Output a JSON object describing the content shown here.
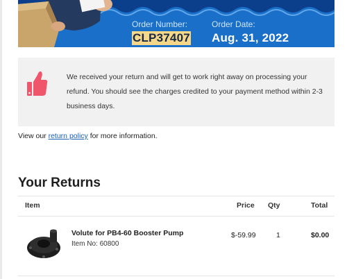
{
  "header": {
    "order_number_label": "Order Number:",
    "order_number": "CLP37407",
    "order_date_label": "Order Date:",
    "order_date": "Aug. 31, 2022",
    "banner_color": "#1a6fc9",
    "highlight_color": "#f5d78a"
  },
  "notice": {
    "icon": "thumbs-up-icon",
    "icon_color": "#f0566b",
    "text": "We received your return and will get to work right away on processing your refund. You should see the charges credited to your payment method within 2-3 business days."
  },
  "policy": {
    "prefix": "View our ",
    "link_text": "return policy",
    "suffix": " for more information."
  },
  "returns": {
    "title": "Your Returns",
    "columns": [
      "Item",
      "Price",
      "Qty",
      "Total"
    ],
    "rows": [
      {
        "name": "Volute for PB4-60 Booster Pump",
        "item_no": "Item No: 60800",
        "price": "$-59.99",
        "qty": "1",
        "total": "$0.00"
      }
    ]
  }
}
